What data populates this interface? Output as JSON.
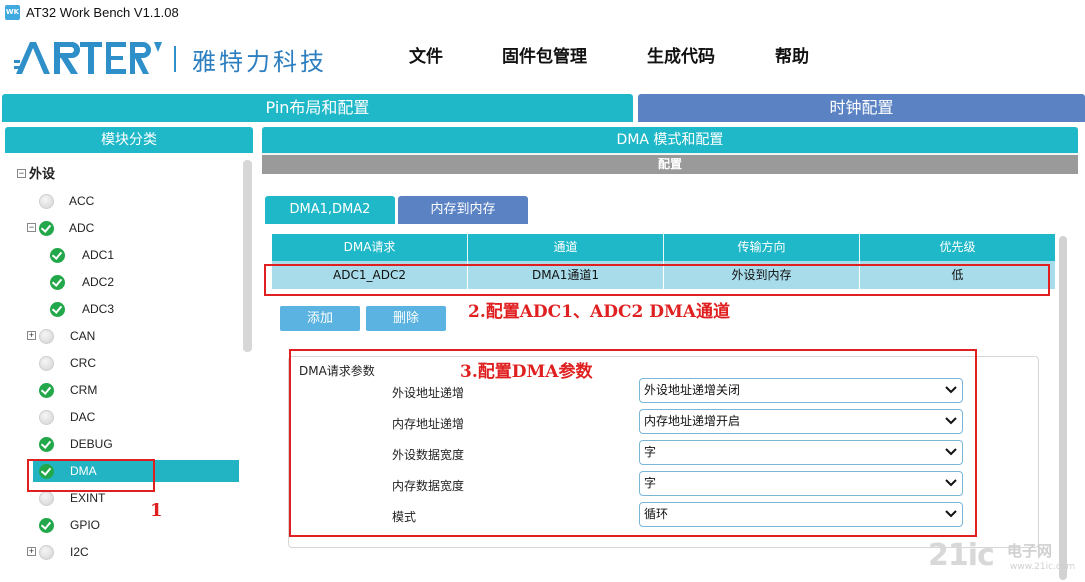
{
  "window": {
    "title": "AT32 Work Bench V1.1.08",
    "icon_text": "WK"
  },
  "header": {
    "logo_text": "ARTERY",
    "brand_cn": "雅特力科技",
    "menu": [
      "文件",
      "固件包管理",
      "生成代码",
      "帮助"
    ]
  },
  "top_tabs": {
    "pin": "Pin布局和配置",
    "clock": "时钟配置"
  },
  "left_panel": {
    "title": "模块分类",
    "root": "外设",
    "items": [
      {
        "label": "ACC",
        "status": "gray"
      },
      {
        "label": "ADC",
        "status": "green",
        "expandable": true
      },
      {
        "label": "ADC1",
        "status": "green"
      },
      {
        "label": "ADC2",
        "status": "green"
      },
      {
        "label": "ADC3",
        "status": "green"
      },
      {
        "label": "CAN",
        "status": "gray",
        "expandable": true
      },
      {
        "label": "CRC",
        "status": "gray"
      },
      {
        "label": "CRM",
        "status": "green"
      },
      {
        "label": "DAC",
        "status": "gray"
      },
      {
        "label": "DEBUG",
        "status": "green"
      },
      {
        "label": "DMA",
        "status": "green",
        "selected": true
      },
      {
        "label": "EXINT",
        "status": "gray"
      },
      {
        "label": "GPIO",
        "status": "green"
      },
      {
        "label": "I2C",
        "status": "gray",
        "expandable": true
      }
    ]
  },
  "right_panel": {
    "title": "DMA 模式和配置",
    "config_bar": "配置",
    "sub_tabs": [
      "DMA1,DMA2",
      "内存到内存"
    ],
    "table": {
      "headers": [
        "DMA请求",
        "通道",
        "传输方向",
        "优先级"
      ],
      "rows": [
        [
          "ADC1_ADC2",
          "DMA1通道1",
          "外设到内存",
          "低"
        ]
      ]
    },
    "buttons": {
      "add": "添加",
      "delete": "删除"
    },
    "params": {
      "title": "DMA请求参数",
      "rows": [
        {
          "label": "外设地址递增",
          "value": "外设地址递增关闭"
        },
        {
          "label": "内存地址递增",
          "value": "内存地址递增开启"
        },
        {
          "label": "外设数据宽度",
          "value": "字"
        },
        {
          "label": "内存数据宽度",
          "value": "字"
        },
        {
          "label": "模式",
          "value": "循环"
        }
      ]
    }
  },
  "annotations": {
    "step1": "1",
    "step2": "2.配置ADC1、ADC2  DMA通道",
    "step3": "3.配置DMA参数",
    "color": "#e02020"
  },
  "watermark": {
    "logo": "21ic",
    "cn": "电子网",
    "url": "www.21ic.com"
  }
}
